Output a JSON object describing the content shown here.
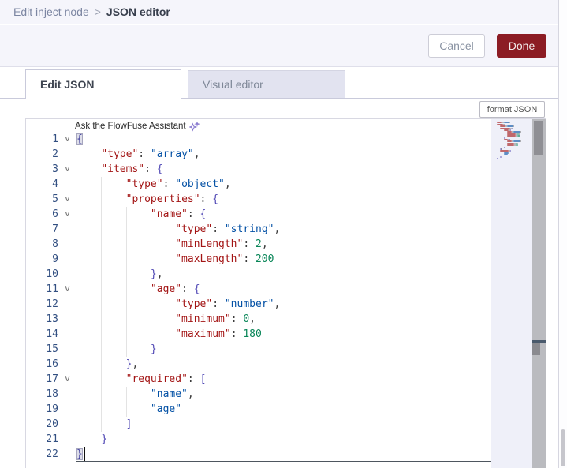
{
  "breadcrumb": {
    "parent": "Edit inject node",
    "separator": ">",
    "current": "JSON editor"
  },
  "actions": {
    "cancel_label": "Cancel",
    "done_label": "Done"
  },
  "tabs": [
    {
      "label": "Edit JSON",
      "active": true
    },
    {
      "label": "Visual editor",
      "active": false
    }
  ],
  "toolbar": {
    "format_button_label": "format JSON"
  },
  "colors": {
    "done_button_bg": "#8C1C24",
    "header_bg": "#F5F5FB",
    "token_key": "#A31515",
    "token_string": "#0451A5",
    "token_number": "#098658",
    "token_bracket": "#4E46B4",
    "line_number": "#335082"
  },
  "editor": {
    "assistant_prompt": "Ask the FlowFuse Assistant",
    "language": "json",
    "cursor": {
      "line": 22,
      "col": 1
    },
    "lines": [
      {
        "num": 1,
        "fold": true,
        "segs": [
          [
            "{",
            "bm"
          ]
        ]
      },
      {
        "num": 2,
        "fold": false,
        "segs": [
          [
            "    ",
            "w"
          ],
          [
            "\"type\"",
            "k"
          ],
          [
            ": ",
            "p"
          ],
          [
            "\"array\"",
            "s"
          ],
          [
            ",",
            "p"
          ]
        ]
      },
      {
        "num": 3,
        "fold": true,
        "segs": [
          [
            "    ",
            "w"
          ],
          [
            "\"items\"",
            "k"
          ],
          [
            ": ",
            "p"
          ],
          [
            "{",
            "b"
          ]
        ]
      },
      {
        "num": 4,
        "fold": false,
        "segs": [
          [
            "        ",
            "w"
          ],
          [
            "\"type\"",
            "k"
          ],
          [
            ": ",
            "p"
          ],
          [
            "\"object\"",
            "s"
          ],
          [
            ",",
            "p"
          ]
        ]
      },
      {
        "num": 5,
        "fold": true,
        "segs": [
          [
            "        ",
            "w"
          ],
          [
            "\"properties\"",
            "k"
          ],
          [
            ": ",
            "p"
          ],
          [
            "{",
            "b"
          ]
        ]
      },
      {
        "num": 6,
        "fold": true,
        "segs": [
          [
            "            ",
            "w"
          ],
          [
            "\"name\"",
            "k"
          ],
          [
            ": ",
            "p"
          ],
          [
            "{",
            "b"
          ]
        ]
      },
      {
        "num": 7,
        "fold": false,
        "segs": [
          [
            "                ",
            "w"
          ],
          [
            "\"type\"",
            "k"
          ],
          [
            ": ",
            "p"
          ],
          [
            "\"string\"",
            "s"
          ],
          [
            ",",
            "p"
          ]
        ]
      },
      {
        "num": 8,
        "fold": false,
        "segs": [
          [
            "                ",
            "w"
          ],
          [
            "\"minLength\"",
            "k"
          ],
          [
            ": ",
            "p"
          ],
          [
            "2",
            "n"
          ],
          [
            ",",
            "p"
          ]
        ]
      },
      {
        "num": 9,
        "fold": false,
        "segs": [
          [
            "                ",
            "w"
          ],
          [
            "\"maxLength\"",
            "k"
          ],
          [
            ": ",
            "p"
          ],
          [
            "200",
            "n"
          ]
        ]
      },
      {
        "num": 10,
        "fold": false,
        "segs": [
          [
            "            ",
            "w"
          ],
          [
            "}",
            "b"
          ],
          [
            ",",
            "p"
          ]
        ]
      },
      {
        "num": 11,
        "fold": true,
        "segs": [
          [
            "            ",
            "w"
          ],
          [
            "\"age\"",
            "k"
          ],
          [
            ": ",
            "p"
          ],
          [
            "{",
            "b"
          ]
        ]
      },
      {
        "num": 12,
        "fold": false,
        "segs": [
          [
            "                ",
            "w"
          ],
          [
            "\"type\"",
            "k"
          ],
          [
            ": ",
            "p"
          ],
          [
            "\"number\"",
            "s"
          ],
          [
            ",",
            "p"
          ]
        ]
      },
      {
        "num": 13,
        "fold": false,
        "segs": [
          [
            "                ",
            "w"
          ],
          [
            "\"minimum\"",
            "k"
          ],
          [
            ": ",
            "p"
          ],
          [
            "0",
            "n"
          ],
          [
            ",",
            "p"
          ]
        ]
      },
      {
        "num": 14,
        "fold": false,
        "segs": [
          [
            "                ",
            "w"
          ],
          [
            "\"maximum\"",
            "k"
          ],
          [
            ": ",
            "p"
          ],
          [
            "180",
            "n"
          ]
        ]
      },
      {
        "num": 15,
        "fold": false,
        "segs": [
          [
            "            ",
            "w"
          ],
          [
            "}",
            "b"
          ]
        ]
      },
      {
        "num": 16,
        "fold": false,
        "segs": [
          [
            "        ",
            "w"
          ],
          [
            "}",
            "b"
          ],
          [
            ",",
            "p"
          ]
        ]
      },
      {
        "num": 17,
        "fold": true,
        "segs": [
          [
            "        ",
            "w"
          ],
          [
            "\"required\"",
            "k"
          ],
          [
            ": ",
            "p"
          ],
          [
            "[",
            "b"
          ]
        ]
      },
      {
        "num": 18,
        "fold": false,
        "segs": [
          [
            "            ",
            "w"
          ],
          [
            "\"name\"",
            "s"
          ],
          [
            ",",
            "p"
          ]
        ]
      },
      {
        "num": 19,
        "fold": false,
        "segs": [
          [
            "            ",
            "w"
          ],
          [
            "\"age\"",
            "s"
          ]
        ]
      },
      {
        "num": 20,
        "fold": false,
        "segs": [
          [
            "        ",
            "w"
          ],
          [
            "]",
            "b"
          ]
        ]
      },
      {
        "num": 21,
        "fold": false,
        "segs": [
          [
            "    ",
            "w"
          ],
          [
            "}",
            "b"
          ]
        ]
      },
      {
        "num": 22,
        "fold": false,
        "current": true,
        "segs": [
          [
            "}",
            "bm"
          ]
        ]
      }
    ]
  }
}
